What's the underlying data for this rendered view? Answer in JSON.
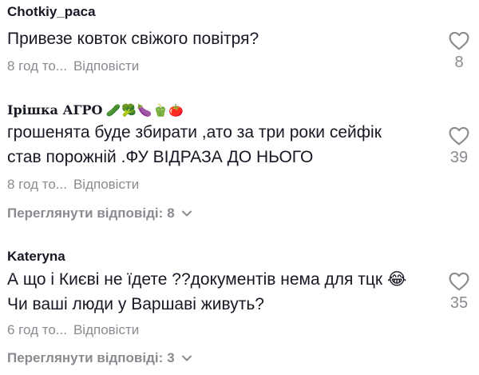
{
  "comments": [
    {
      "username": "Chotkiy_paca",
      "username_emoji": "",
      "text_lines": [
        "Привезе ковток свіжого повітря?"
      ],
      "time": "8 год то...",
      "reply_label": "Відповісти",
      "likes": "8",
      "view_replies_label": "",
      "view_replies_count": ""
    },
    {
      "username": "Ірішка АГРО",
      "username_emoji": "🥒🥦🍆🫑🍅",
      "text_lines": [
        "грошенята буде збирати ,ато за три роки сейфік",
        "став порожній .ФУ ВІДРАЗА ДО НЬОГО"
      ],
      "time": "8 год то...",
      "reply_label": "Відповісти",
      "likes": "39",
      "view_replies_label": "Переглянути відповіді:",
      "view_replies_count": "8"
    },
    {
      "username": "Kateryna",
      "username_emoji": "",
      "text_lines": [
        "А що і Києві не їдете ??документів нема для тцк 😂",
        "Чи ваші люди у Варшаві живуть?"
      ],
      "time": "6 год то...",
      "reply_label": "Відповісти",
      "likes": "35",
      "view_replies_label": "Переглянути відповіді:",
      "view_replies_count": "3"
    }
  ],
  "colors": {
    "text": "#161823",
    "muted": "#8a8b91",
    "background": "#ffffff"
  },
  "icons": {
    "like": "heart-outline-icon",
    "expand": "chevron-down-icon"
  }
}
